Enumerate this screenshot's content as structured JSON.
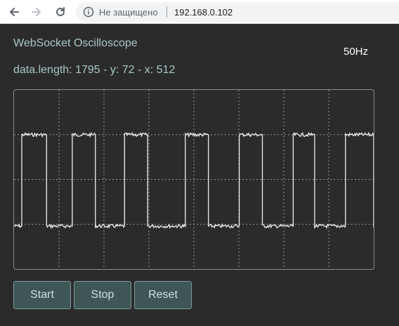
{
  "browser": {
    "security_label": "Не защищено",
    "url": "192.168.0.102"
  },
  "page": {
    "title": "WebSocket Oscilloscope",
    "frequency": "50Hz",
    "data_info": "data.length: 1795 - y: 72 - x: 512"
  },
  "chart_data": {
    "type": "line",
    "grid": true,
    "grid_divisions": {
      "x": 8,
      "y": 4
    },
    "waveform": "square",
    "series": [
      {
        "high_level": 0.75,
        "low_level": 0.24,
        "high_segments": [
          [
            0.02,
            0.09
          ],
          [
            0.16,
            0.225
          ],
          [
            0.305,
            0.37
          ],
          [
            0.475,
            0.54
          ],
          [
            0.625,
            0.69
          ],
          [
            0.775,
            0.835
          ],
          [
            0.92,
            1.0
          ]
        ]
      }
    ],
    "trace_color": "#f0f0f0",
    "grid_color": "#9a9a9a"
  },
  "controls": {
    "start": "Start",
    "stop": "Stop",
    "reset": "Reset"
  }
}
